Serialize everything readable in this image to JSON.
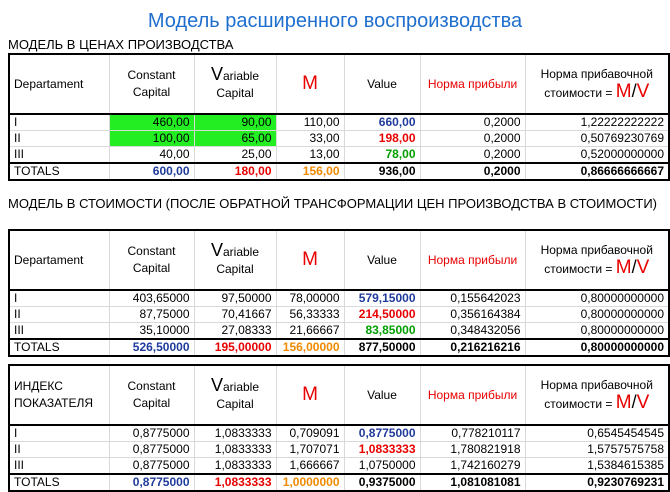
{
  "title": "Модель расширенного воспроизводства",
  "headers": {
    "departament": "Departament",
    "constant": "Constant Capital",
    "variable_v": "V",
    "variable_rest": "ariable Capital",
    "m": "M",
    "value": "Value",
    "profit_rate": "Норма прибыли",
    "surplus_rate": "Норма прибавочной стоимости =",
    "surplus_m": "M",
    "surplus_slash": "/",
    "surplus_v": "V",
    "index_label": "ИНДЕКС ПОКАЗАТЕЛЯ"
  },
  "table1": {
    "caption": "МОДЕЛЬ В ЦЕНАХ ПРОИЗВОДСТВА",
    "rows": [
      {
        "dept": "I",
        "cc": "460,00",
        "vc": "90,00",
        "m": "110,00",
        "value": "660,00",
        "profit": "0,2000",
        "surplus": "1,22222222222"
      },
      {
        "dept": "II",
        "cc": "100,00",
        "vc": "65,00",
        "m": "33,00",
        "value": "198,00",
        "profit": "0,2000",
        "surplus": "0,50769230769"
      },
      {
        "dept": "III",
        "cc": "40,00",
        "vc": "25,00",
        "m": "13,00",
        "value": "78,00",
        "profit": "0,2000",
        "surplus": "0,52000000000"
      }
    ],
    "totals": {
      "dept": "TOTALS",
      "cc": "600,00",
      "vc": "180,00",
      "m": "156,00",
      "value": "936,00",
      "profit": "0,2000",
      "surplus": "0,86666666667"
    }
  },
  "table2": {
    "caption": "МОДЕЛЬ В СТОИМОСТИ (ПОСЛЕ ОБРАТНОЙ ТРАНСФОРМАЦИИ ЦЕН ПРОИЗВОДСТВА В СТОИМОСТИ)",
    "rows": [
      {
        "dept": "I",
        "cc": "403,65000",
        "vc": "97,50000",
        "m": "78,00000",
        "value": "579,15000",
        "profit": "0,155642023",
        "surplus": "0,80000000000"
      },
      {
        "dept": "II",
        "cc": "87,75000",
        "vc": "70,41667",
        "m": "56,33333",
        "value": "214,50000",
        "profit": "0,356164384",
        "surplus": "0,80000000000"
      },
      {
        "dept": "III",
        "cc": "35,10000",
        "vc": "27,08333",
        "m": "21,66667",
        "value": "83,85000",
        "profit": "0,348432056",
        "surplus": "0,80000000000"
      }
    ],
    "totals": {
      "dept": "TOTALS",
      "cc": "526,50000",
      "vc": "195,00000",
      "m": "156,00000",
      "value": "877,50000",
      "profit": "0,216216216",
      "surplus": "0,80000000000"
    }
  },
  "table3": {
    "rows": [
      {
        "dept": "I",
        "cc": "0,8775000",
        "vc": "1,0833333",
        "m": "0,709091",
        "value": "0,8775000",
        "profit": "0,778210117",
        "surplus": "0,6545454545"
      },
      {
        "dept": "II",
        "cc": "0,8775000",
        "vc": "1,0833333",
        "m": "1,707071",
        "value": "1,0833333",
        "profit": "1,780821918",
        "surplus": "1,5757575758"
      },
      {
        "dept": "III",
        "cc": "0,8775000",
        "vc": "1,0833333",
        "m": "1,666667",
        "value": "1,0750000",
        "profit": "1,742160279",
        "surplus": "1,5384615385"
      }
    ],
    "totals": {
      "dept": "TOTALS",
      "cc": "0,8775000",
      "vc": "1,0833333",
      "m": "1,0000000",
      "value": "0,9375000",
      "profit": "1,081081081",
      "surplus": "0,9230769231"
    }
  },
  "colors": {
    "title": "#1f6fcf",
    "red": "#e80000",
    "blue": "#1f3b9c",
    "green_text": "#00a000",
    "orange": "#f08a00",
    "green_fill": "#22ee22"
  }
}
